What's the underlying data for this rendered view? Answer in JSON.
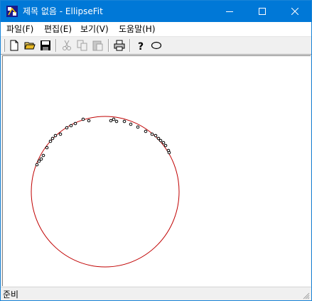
{
  "window": {
    "title": "제목 없음 - EllipseFit"
  },
  "titlebar_buttons": [
    {
      "name": "minimize-button",
      "icon": "minimize-icon"
    },
    {
      "name": "maximize-button",
      "icon": "maximize-icon"
    },
    {
      "name": "close-button",
      "icon": "close-icon"
    }
  ],
  "menu": [
    {
      "label": "파일(F)"
    },
    {
      "label": "편집(E)"
    },
    {
      "label": "보기(V)"
    },
    {
      "label": "도움말(H)"
    }
  ],
  "toolbar": {
    "buttons": [
      {
        "icon": "new-file-icon",
        "enabled": true
      },
      {
        "icon": "open-folder-icon",
        "enabled": true
      },
      {
        "icon": "save-icon",
        "enabled": true
      },
      {
        "icon": "cut-icon",
        "enabled": false
      },
      {
        "icon": "copy-icon",
        "enabled": false
      },
      {
        "icon": "paste-icon",
        "enabled": false
      },
      {
        "icon": "print-icon",
        "enabled": true
      },
      {
        "icon": "help-icon",
        "enabled": true
      },
      {
        "icon": "ellipse-icon",
        "enabled": true
      }
    ]
  },
  "canvas": {
    "ellipse_color": "#c00000",
    "point_color": "#000000"
  },
  "status": {
    "text": "준비"
  }
}
